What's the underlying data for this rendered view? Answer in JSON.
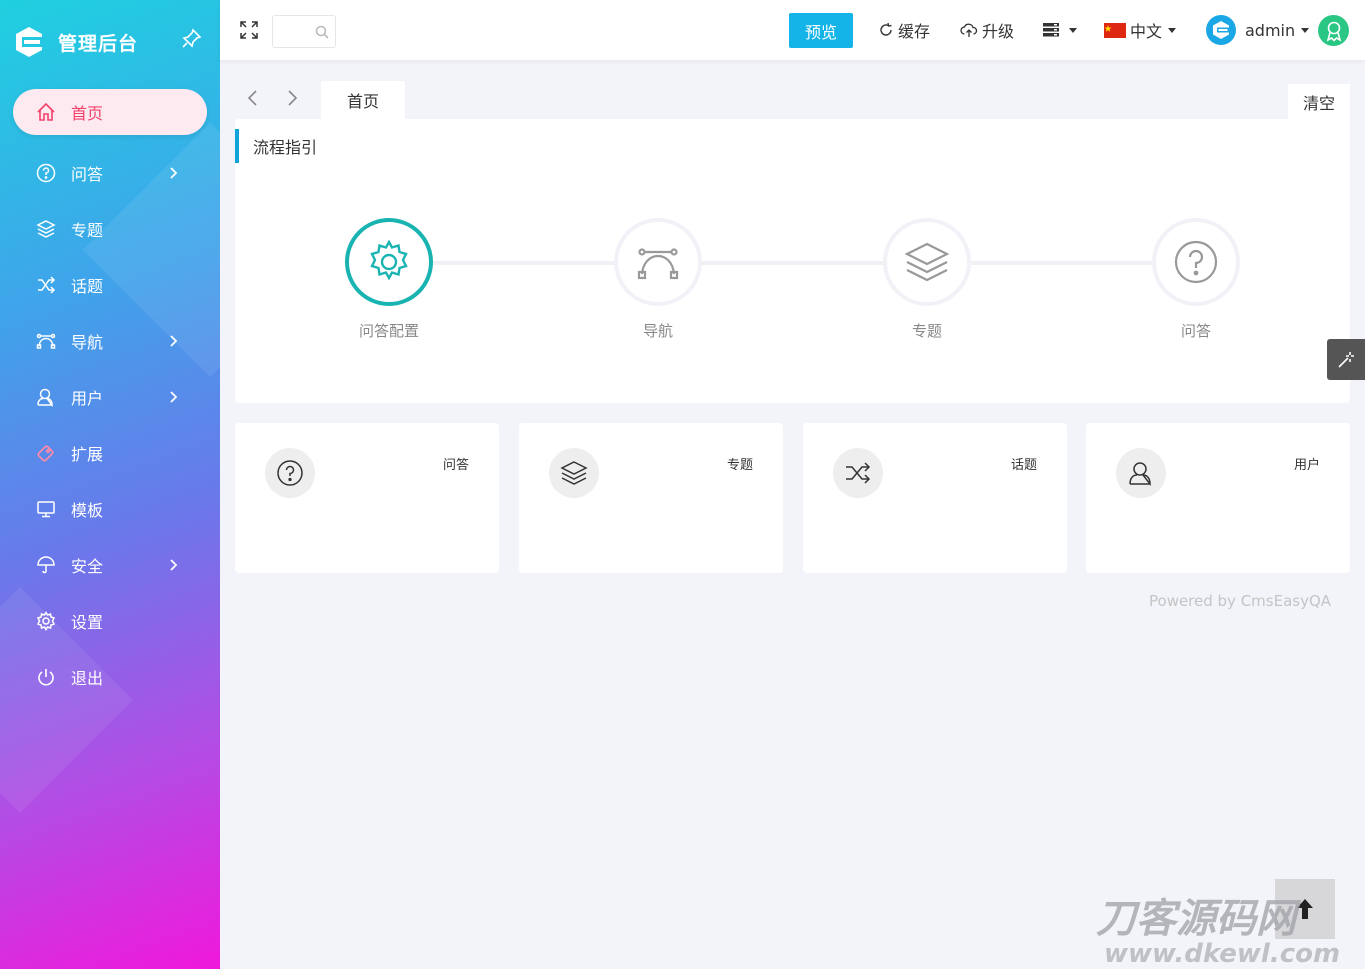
{
  "brand": {
    "title": "管理后台",
    "logo": "cmseasy-logo",
    "pin_icon": "pin-icon"
  },
  "sidebar": {
    "items": [
      {
        "label": "首页",
        "icon": "home-icon",
        "active": true,
        "has_arrow": false
      },
      {
        "label": "问答",
        "icon": "question-circle-icon",
        "has_arrow": true
      },
      {
        "label": "专题",
        "icon": "layers-icon",
        "has_arrow": false
      },
      {
        "label": "话题",
        "icon": "shuffle-icon",
        "has_arrow": false
      },
      {
        "label": "导航",
        "icon": "bezier-icon",
        "has_arrow": true
      },
      {
        "label": "用户",
        "icon": "user-icon",
        "has_arrow": true
      },
      {
        "label": "扩展",
        "icon": "puzzle-icon",
        "has_arrow": false
      },
      {
        "label": "模板",
        "icon": "monitor-icon",
        "has_arrow": false
      },
      {
        "label": "安全",
        "icon": "umbrella-icon",
        "has_arrow": true
      },
      {
        "label": "设置",
        "icon": "gear-icon",
        "has_arrow": false
      },
      {
        "label": "退出",
        "icon": "power-icon",
        "has_arrow": false
      }
    ],
    "active_color": "#f2426b"
  },
  "header": {
    "search_placeholder": "",
    "preview_label": "预览",
    "cache_label": "缓存",
    "upgrade_label": "升级",
    "language_label": "中文",
    "user_label": "admin",
    "accent": "#15b4e8"
  },
  "tabs": {
    "home_label": "首页",
    "clear_label": "清空"
  },
  "flow": {
    "title": "流程指引",
    "steps": [
      {
        "label": "问答配置",
        "icon": "gear-icon",
        "active": true
      },
      {
        "label": "导航",
        "icon": "bezier-icon",
        "active": false
      },
      {
        "label": "专题",
        "icon": "layers-icon",
        "active": false
      },
      {
        "label": "问答",
        "icon": "question-circle-icon",
        "active": false
      }
    ],
    "active_color": "#19b3b1"
  },
  "stats": [
    {
      "label": "问答",
      "icon": "question-circle-icon"
    },
    {
      "label": "专题",
      "icon": "layers-icon"
    },
    {
      "label": "话题",
      "icon": "shuffle-icon"
    },
    {
      "label": "用户",
      "icon": "user-icon"
    }
  ],
  "footer": {
    "powered": "Powered by CmsEasyQA"
  },
  "watermark": {
    "text": "刀客源码网",
    "url_text": "www.dkewl.com"
  }
}
